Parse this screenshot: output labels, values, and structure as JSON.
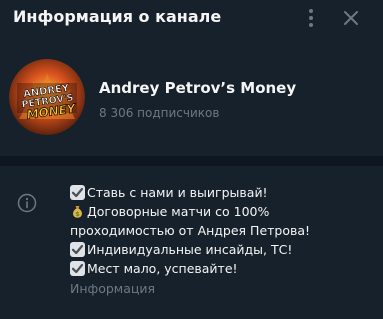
{
  "header": {
    "title": "Информация о канале"
  },
  "channel": {
    "name": "Andrey Petrov’s Money",
    "subscribers": "8 306 подписчиков",
    "avatar_text_line1": "ANDREY",
    "avatar_text_line2": "PETROV'S",
    "avatar_text_line3": "MONEY"
  },
  "description": {
    "lines": [
      {
        "icon": "check-mark-icon",
        "text": "Ставь с нами и выигрывай!"
      },
      {
        "icon": "money-bag-icon",
        "text": "Договорные матчи со 100%"
      },
      {
        "icon": "",
        "text": "проходимостью от Андрея Петрова!"
      },
      {
        "icon": "check-mark-icon",
        "text": "Индивидуальные инсайды, ТС!"
      },
      {
        "icon": "check-mark-icon",
        "text": "Мест мало, успевайте!"
      }
    ],
    "label": "Информация"
  },
  "colors": {
    "background": "#17212b",
    "divider": "#0e1621",
    "text": "#f5f5f5",
    "muted": "#6d7883"
  }
}
